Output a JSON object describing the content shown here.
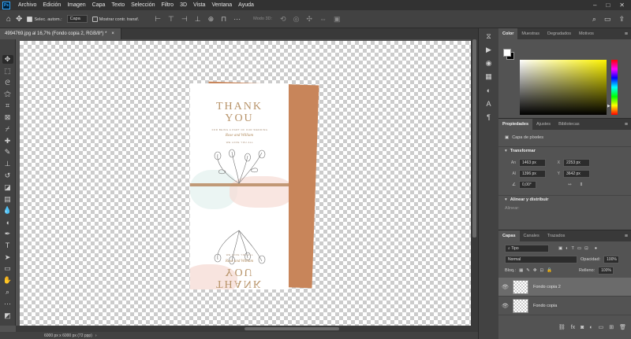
{
  "menu": {
    "logo": "Ps",
    "items": [
      "Archivo",
      "Edición",
      "Imagen",
      "Capa",
      "Texto",
      "Selección",
      "Filtro",
      "3D",
      "Vista",
      "Ventana",
      "Ayuda"
    ],
    "window_controls": [
      "–",
      "□",
      "✕"
    ]
  },
  "options": {
    "home_icon": "home-icon",
    "move_icon": "move-icon",
    "auto_select_label": "Selec. autom.:",
    "auto_select_checked": true,
    "target_select": "Capa",
    "transform_label": "Mostrar contr. transf.",
    "transform_checked": false,
    "mode3d_label": "Modo 3D:",
    "right_icons": [
      "search-icon",
      "workspace-icon",
      "share-icon"
    ]
  },
  "document": {
    "tab_title": "4994769.jpg al 16,7% (Fondo copia 2, RGB/8*) *",
    "tab_close": "×",
    "status": "6000 px x 6000 px (72 ppp)",
    "status_arrow": "›"
  },
  "card": {
    "headline_line1": "THANK",
    "headline_line2": "YOU",
    "small_text_1": "FOR BEING A PART OF OUR WEDDING",
    "names": "Rose and William",
    "small_text_2": "WE LOVE YOU ALL"
  },
  "color_panel": {
    "tabs": [
      "Color",
      "Muestras",
      "Degradados",
      "Motivos"
    ],
    "active_tab": "Color",
    "foreground": "#ffffff",
    "background": "#000000",
    "hue_color": "#fdf300"
  },
  "properties": {
    "tabs": [
      "Propiedades",
      "Ajustes",
      "Bibliotecas"
    ],
    "active_tab": "Propiedades",
    "layer_kind": "Capa de píxeles",
    "transform_title": "Transformar",
    "w_label": "An",
    "w_value": "1463 px",
    "x_label": "X",
    "x_value": "2253 px",
    "h_label": "Al",
    "h_value": "1396 px",
    "y_label": "Y",
    "y_value": "3642 px",
    "angle_value": "0,00°",
    "align_title": "Alinear y distribuir",
    "align_sub": "Alinear:"
  },
  "layers": {
    "tabs": [
      "Capas",
      "Canales",
      "Trazados"
    ],
    "active_tab": "Capas",
    "filter_label": "Tipo",
    "blend_mode": "Normal",
    "opacity_label": "Opacidad:",
    "opacity_value": "100%",
    "lock_label": "Bloq.:",
    "fill_label": "Relleno:",
    "fill_value": "100%",
    "items": [
      {
        "name": "Fondo copia 2",
        "visible": true,
        "selected": true
      },
      {
        "name": "Fondo copia",
        "visible": true,
        "selected": false
      }
    ]
  }
}
